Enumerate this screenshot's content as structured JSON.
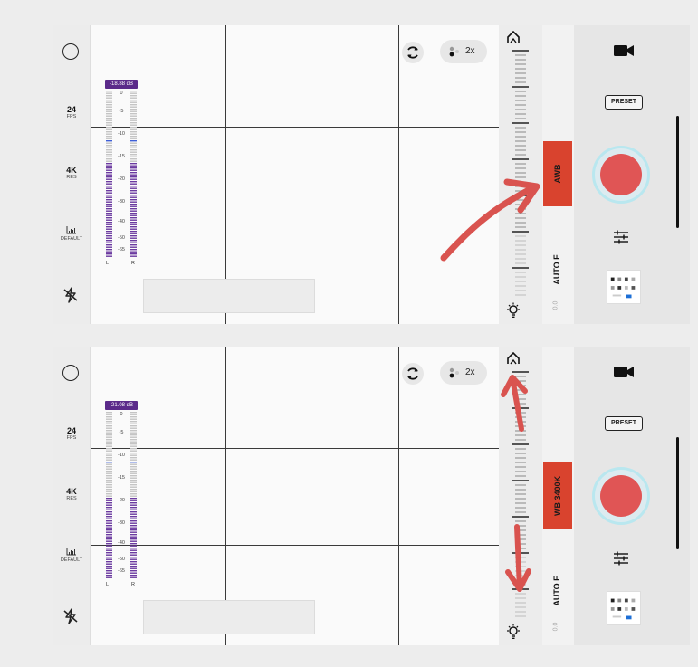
{
  "panels": [
    {
      "left": {
        "fps_value": "24",
        "fps_label": "FPS",
        "res_value": "4K",
        "res_label": "RES",
        "profile_label": "DEFAULT"
      },
      "meter": {
        "db_reading": "-18.88 dB",
        "scale": [
          "0",
          "-5",
          "-10",
          "-15",
          "-20",
          "-30",
          "-40",
          "-50",
          "-65"
        ],
        "channels": [
          "L",
          "R"
        ]
      },
      "zoom_label": "2x",
      "white_balance": {
        "label": "AWB"
      },
      "focus": {
        "label": "AUTO F",
        "value": "0.0"
      },
      "preset_label": "PRESET"
    },
    {
      "left": {
        "fps_value": "24",
        "fps_label": "FPS",
        "res_value": "4K",
        "res_label": "RES",
        "profile_label": "DEFAULT"
      },
      "meter": {
        "db_reading": "-21.08 dB",
        "scale": [
          "0",
          "-5",
          "-10",
          "-15",
          "-20",
          "-30",
          "-40",
          "-50",
          "-65"
        ],
        "channels": [
          "L",
          "R"
        ]
      },
      "zoom_label": "2x",
      "white_balance": {
        "label": "WB 3400K"
      },
      "focus": {
        "label": "AUTO F",
        "value": "0.0"
      },
      "preset_label": "PRESET"
    }
  ],
  "colors": {
    "accent_red": "#d9432e",
    "record_red": "#e05555",
    "meter_purple": "#5b2a8a",
    "annotation_arrow": "#d9534f"
  },
  "icons": [
    "circle-icon",
    "flash-off-icon",
    "histogram-icon",
    "flip-camera-icon",
    "lens-dots-icon",
    "home-icon",
    "bulb-icon",
    "video-camera-icon",
    "sliders-icon"
  ]
}
